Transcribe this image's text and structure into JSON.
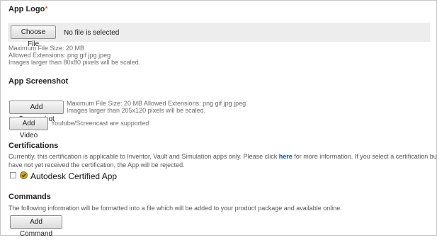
{
  "app_logo": {
    "heading": "App Logo",
    "required_mark": "*",
    "choose_file_label": "Choose File",
    "no_file_text": "No file is selected",
    "notes": [
      "Maximum File Size: 20 MB",
      "Allowed Extensions: png gif jpg jpeg",
      "Images larger than 80x80 pixels will be scaled."
    ]
  },
  "app_screenshot": {
    "heading": "App Screenshot",
    "add_screenshot_label": "Add Screenshot",
    "screenshot_note_line1": "Maximum File Size: 20 MB Allowed Extensions: png gif jpg jpeg",
    "screenshot_note_line2": "Images larger than 205x120 pixels will be scaled.",
    "add_video_label": "Add Video",
    "video_note": "Youtube/Screencast are supported"
  },
  "certifications": {
    "heading": "Certifications",
    "text_before_link": "Currently, this certification is applicable to Inventor, Vault and Simulation apps only. Please click ",
    "link_text": "here",
    "text_after_link": " for more information. If you select a certification but",
    "text_line2": "have not yet received the certification, the App will be rejected.",
    "checkbox_label": "Autodesk Certified App",
    "checked": false,
    "icon": "certified-badge-icon",
    "icon_color": "#c9a227"
  },
  "commands": {
    "heading": "Commands",
    "description": "The following information will be formatted into a file which will be added to your product package and available online.",
    "add_command_label": "Add Command"
  }
}
